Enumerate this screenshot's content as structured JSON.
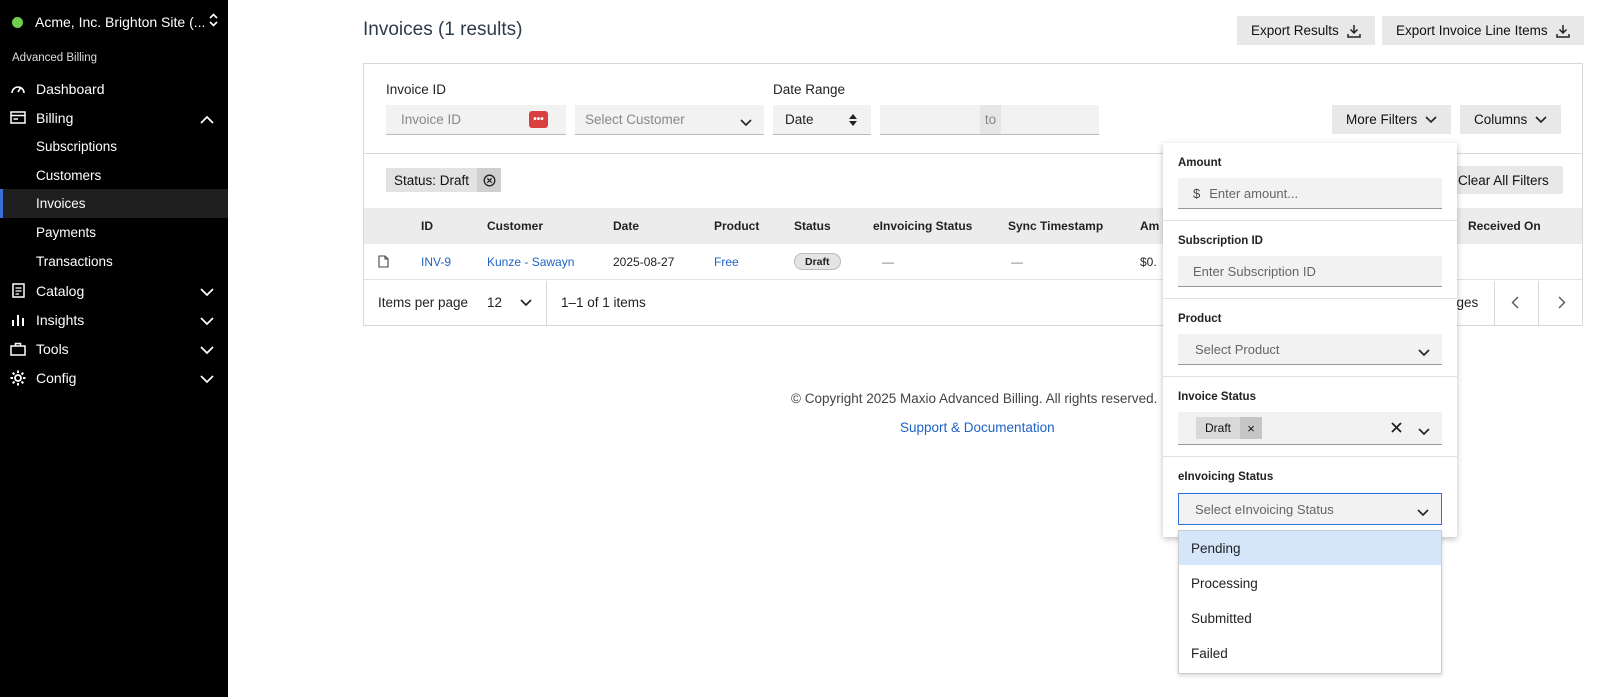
{
  "sidebar": {
    "site_name": "Acme, Inc. Brighton Site (...",
    "section_label": "Advanced Billing",
    "items": {
      "dashboard": "Dashboard",
      "billing": "Billing",
      "subscriptions": "Subscriptions",
      "customers": "Customers",
      "invoices": "Invoices",
      "payments": "Payments",
      "transactions": "Transactions",
      "catalog": "Catalog",
      "insights": "Insights",
      "tools": "Tools",
      "config": "Config"
    },
    "active_item": "Invoices"
  },
  "header": {
    "title": "Invoices (1 results)",
    "export_results": "Export Results",
    "export_line_items": "Export Invoice Line Items"
  },
  "filters": {
    "invoice_id_label": "Invoice ID",
    "invoice_id_placeholder": "Invoice ID",
    "customer_placeholder": "Select Customer",
    "date_range_label": "Date Range",
    "date_select": "Date",
    "to_label": "to",
    "more_filters": "More Filters",
    "columns": "Columns",
    "active_tag": "Status: Draft",
    "clear_all": "Clear All Filters"
  },
  "table": {
    "headers": {
      "id": "ID",
      "customer": "Customer",
      "date": "Date",
      "product": "Product",
      "status": "Status",
      "einvoicing": "eInvoicing Status",
      "sync": "Sync Timestamp",
      "amount": "Am",
      "received": "Received On"
    },
    "rows": [
      {
        "id": "INV-9",
        "customer": "Kunze - Sawayn",
        "date": "2025-08-27",
        "product": "Free",
        "status": "Draft",
        "einvoicing": "—",
        "sync": "—",
        "amount": "$0."
      }
    ]
  },
  "pagination": {
    "items_per_page_label": "Items per page",
    "items_per_page": "12",
    "range": "1–1 of 1 items",
    "pages_text": "ages"
  },
  "footer": {
    "copyright": "© Copyright 2025 Maxio Advanced Billing. All rights reserved.",
    "support_link": "Support & Documentation"
  },
  "more_filters": {
    "amount_label": "Amount",
    "currency_symbol": "$",
    "amount_placeholder": "Enter amount...",
    "subscription_label": "Subscription ID",
    "subscription_placeholder": "Enter Subscription ID",
    "product_label": "Product",
    "product_placeholder": "Select Product",
    "invoice_status_label": "Invoice Status",
    "invoice_status_chip": "Draft",
    "einvoicing_label": "eInvoicing Status",
    "einvoicing_placeholder": "Select eInvoicing Status",
    "einvoicing_options": [
      "Pending",
      "Processing",
      "Submitted",
      "Failed"
    ]
  },
  "colors": {
    "sidebar_bg": "#000000",
    "accent_link": "#1e63c4",
    "active_border": "#3b6fd6",
    "status_dot": "#6fcf4b",
    "option_highlight": "#d6e6fa"
  }
}
